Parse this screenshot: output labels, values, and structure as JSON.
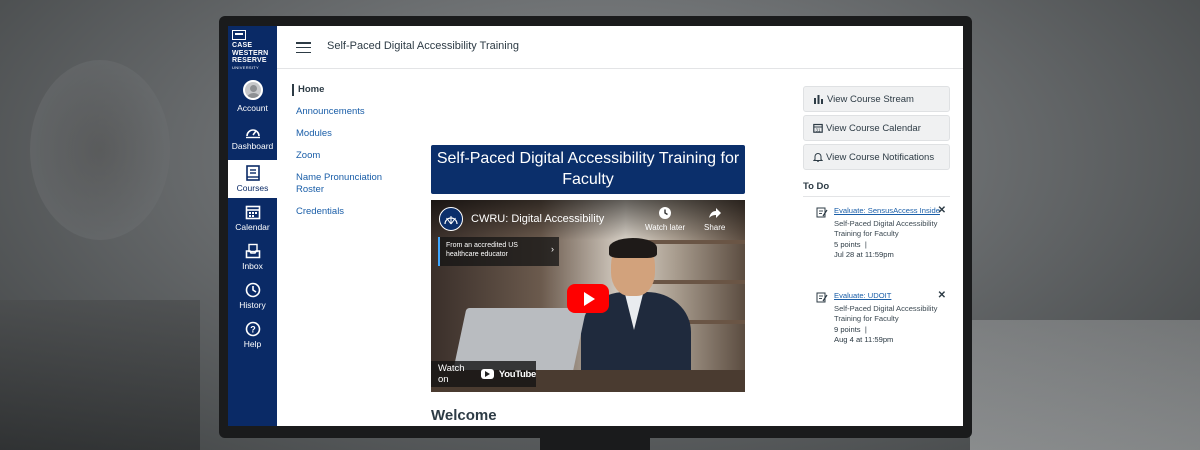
{
  "university": {
    "line1": "CASE",
    "line2": "WESTERN",
    "line3": "RESERVE",
    "line4": "UNIVERSITY"
  },
  "global_nav": [
    {
      "label": "Account",
      "icon": "avatar-icon"
    },
    {
      "label": "Dashboard",
      "icon": "dashboard-icon"
    },
    {
      "label": "Courses",
      "icon": "courses-icon",
      "active": true
    },
    {
      "label": "Calendar",
      "icon": "calendar-icon"
    },
    {
      "label": "Inbox",
      "icon": "inbox-icon"
    },
    {
      "label": "History",
      "icon": "history-icon"
    },
    {
      "label": "Help",
      "icon": "help-icon"
    }
  ],
  "header": {
    "breadcrumb": "Self-Paced Digital Accessibility Training"
  },
  "course_nav": [
    {
      "label": "Home",
      "active": true
    },
    {
      "label": "Announcements"
    },
    {
      "label": "Modules"
    },
    {
      "label": "Zoom"
    },
    {
      "label": "Name Pronunciation Roster"
    },
    {
      "label": "Credentials"
    }
  ],
  "main": {
    "banner": "Self-Paced Digital Accessibility Training for Faculty",
    "video": {
      "title": "CWRU: Digital Accessibility",
      "watch_later": "Watch later",
      "share": "Share",
      "info_panel": "From an accredited US healthcare educator",
      "watch_on": "Watch on",
      "youtube": "YouTube"
    },
    "welcome": "Welcome"
  },
  "sidebar": {
    "buttons": [
      {
        "label": "View Course Stream",
        "icon": "bar-chart-icon"
      },
      {
        "label": "View Course Calendar",
        "icon": "calendar-icon"
      },
      {
        "label": "View Course Notifications",
        "icon": "bell-icon"
      }
    ],
    "todo_heading": "To Do",
    "todo_items": [
      {
        "title": "Evaluate: SensusAccess Inside",
        "course": "Self-Paced Digital Accessibility Training for Faculty",
        "points": "5 points",
        "due": "Jul 28 at 11:59pm"
      },
      {
        "title": "Evaluate: UDOIT",
        "course": "Self-Paced Digital Accessibility Training for Faculty",
        "points": "9 points",
        "due": "Aug 4 at 11:59pm"
      }
    ]
  },
  "colors": {
    "nav_bg": "#0a2a66",
    "link": "#1a5ea8",
    "banner_bg": "#0b2f6b",
    "youtube_red": "#ff0000"
  }
}
